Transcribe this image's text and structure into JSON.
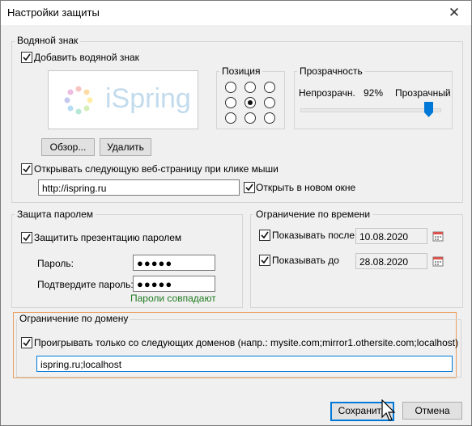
{
  "dialog": {
    "title": "Настройки защиты",
    "close_glyph": "✕"
  },
  "watermark": {
    "group_label": "Водяной знак",
    "add_checkbox": {
      "label": "Добавить водяной знак",
      "checked": true
    },
    "preview_logo_text": "iSpring",
    "browse_button": "Обзор...",
    "delete_button": "Удалить",
    "position": {
      "label": "Позиция",
      "selected_index": 4
    },
    "transparency": {
      "label": "Прозрачность",
      "left_label": "Непрозрачн.",
      "value_text": "92%",
      "right_label": "Прозрачный",
      "value": 0.92
    },
    "open_url_checkbox": {
      "label": "Открывать следующую веб-страницу при клике мыши",
      "checked": true
    },
    "url_value": "http://ispring.ru",
    "new_window_checkbox": {
      "label": "Открыть в новом окне",
      "checked": true
    }
  },
  "password": {
    "group_label": "Защита паролем",
    "protect_checkbox": {
      "label": "Защитить презентацию паролем",
      "checked": true
    },
    "password_label": "Пароль:",
    "password_value": "●●●●●",
    "confirm_label": "Подтвердите пароль:",
    "confirm_value": "●●●●●",
    "match_text": "Пароли совпадают",
    "match_color": "#1f7a1f"
  },
  "time": {
    "group_label": "Ограничение по времени",
    "show_after": {
      "label": "Показывать после",
      "checked": true,
      "date": "10.08.2020"
    },
    "show_until": {
      "label": "Показывать до",
      "checked": true,
      "date": "28.08.2020"
    }
  },
  "domain": {
    "group_label": "Ограничение по домену",
    "only_domains_checkbox": {
      "label": "Проигрывать только со следующих доменов (напр.: mysite.com;mirror1.othersite.com;localhost)",
      "checked": true
    },
    "domains_value": "ispring.ru;localhost",
    "highlight_color": "#e8a060"
  },
  "footer": {
    "save_button": "Сохранить",
    "cancel_button": "Отмена"
  }
}
